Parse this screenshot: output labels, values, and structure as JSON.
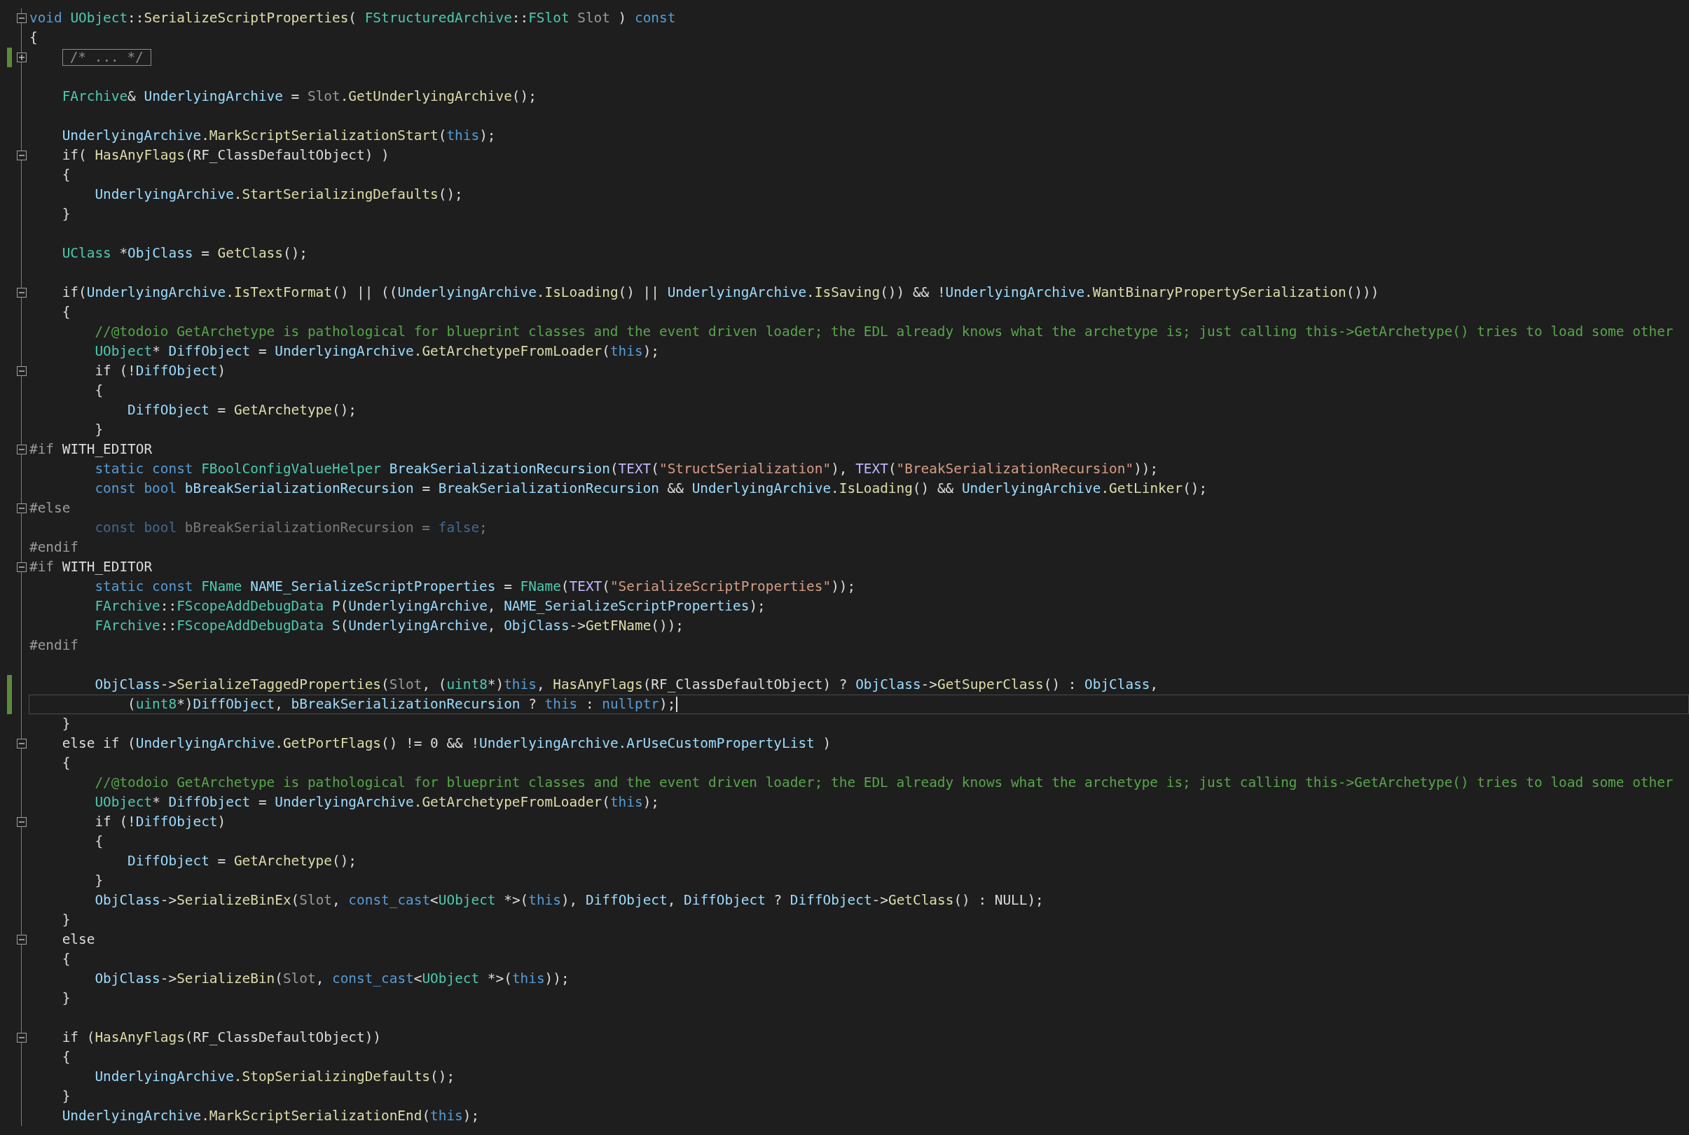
{
  "editor": {
    "lines": [
      {
        "expanded": true,
        "changed": false,
        "current": false,
        "tokens": [
          {
            "kind": "kw",
            "text": "void "
          },
          {
            "kind": "type",
            "text": "UObject"
          },
          {
            "kind": "plain",
            "text": "::"
          },
          {
            "kind": "fn",
            "text": "SerializeScriptProperties"
          },
          {
            "kind": "plain",
            "text": "( "
          },
          {
            "kind": "type",
            "text": "FStructuredArchive"
          },
          {
            "kind": "plain",
            "text": "::"
          },
          {
            "kind": "type",
            "text": "FSlot "
          },
          {
            "kind": "param",
            "text": "Slot"
          },
          {
            "kind": "plain",
            "text": " ) "
          },
          {
            "kind": "kw",
            "text": "const"
          }
        ]
      },
      {
        "changed": false,
        "current": false,
        "tokens": [
          {
            "kind": "plain",
            "text": "{"
          }
        ]
      },
      {
        "expanded": false,
        "changed": true,
        "current": false,
        "tokens": [
          {
            "kind": "collapsed",
            "text": "/* ... */"
          }
        ]
      },
      {
        "changed": false,
        "current": false
      },
      {
        "changed": false,
        "current": false,
        "tokens": [
          {
            "kind": "type",
            "text": "    FArchive"
          },
          {
            "kind": "plain",
            "text": "& "
          },
          {
            "kind": "var",
            "text": "UnderlyingArchive"
          },
          {
            "kind": "plain",
            "text": " = "
          },
          {
            "kind": "param",
            "text": "Slot"
          },
          {
            "kind": "fn",
            "text": ".GetUnderlyingArchive"
          },
          {
            "kind": "plain",
            "text": "();"
          }
        ]
      },
      {
        "changed": false,
        "current": false
      },
      {
        "changed": false,
        "current": false,
        "tokens": [
          {
            "kind": "var",
            "text": "    UnderlyingArchive"
          },
          {
            "kind": "fn",
            "text": ".MarkScriptSerializationStart"
          },
          {
            "kind": "plain",
            "text": "("
          },
          {
            "kind": "kw",
            "text": "this"
          },
          {
            "kind": "plain",
            "text": ");"
          }
        ]
      },
      {
        "expanded": true,
        "changed": false,
        "current": false,
        "tokens": [
          {
            "kind": "plain",
            "text": "    if( "
          },
          {
            "kind": "fn",
            "text": "HasAnyFlags"
          },
          {
            "kind": "plain",
            "text": "(RF_ClassDefaultObject) )"
          }
        ]
      },
      {
        "changed": false,
        "current": false,
        "tokens": [
          {
            "kind": "plain",
            "text": "    {"
          }
        ]
      },
      {
        "changed": false,
        "current": false,
        "tokens": [
          {
            "kind": "var",
            "text": "        UnderlyingArchive"
          },
          {
            "kind": "fn",
            "text": ".StartSerializingDefaults"
          },
          {
            "kind": "plain",
            "text": "();"
          }
        ]
      },
      {
        "changed": false,
        "current": false,
        "tokens": [
          {
            "kind": "plain",
            "text": "    }"
          }
        ]
      },
      {
        "changed": false,
        "current": false
      },
      {
        "changed": false,
        "current": false,
        "tokens": [
          {
            "kind": "type",
            "text": "    UClass"
          },
          {
            "kind": "plain",
            "text": " *"
          },
          {
            "kind": "var",
            "text": "ObjClass"
          },
          {
            "kind": "plain",
            "text": " = "
          },
          {
            "kind": "fn",
            "text": "GetClass"
          },
          {
            "kind": "plain",
            "text": "();"
          }
        ]
      },
      {
        "changed": false,
        "current": false
      },
      {
        "expanded": true,
        "changed": false,
        "current": false,
        "tokens": [
          {
            "kind": "plain",
            "text": "    if("
          },
          {
            "kind": "var",
            "text": "UnderlyingArchive"
          },
          {
            "kind": "fn",
            "text": ".IsTextFormat"
          },
          {
            "kind": "plain",
            "text": "() || (("
          },
          {
            "kind": "var",
            "text": "UnderlyingArchive"
          },
          {
            "kind": "fn",
            "text": ".IsLoading"
          },
          {
            "kind": "plain",
            "text": "() || "
          },
          {
            "kind": "var",
            "text": "UnderlyingArchive"
          },
          {
            "kind": "fn",
            "text": ".IsSaving"
          },
          {
            "kind": "plain",
            "text": "()) && !"
          },
          {
            "kind": "var",
            "text": "UnderlyingArchive"
          },
          {
            "kind": "fn",
            "text": ".WantBinaryPropertySerialization"
          },
          {
            "kind": "plain",
            "text": "()))"
          }
        ]
      },
      {
        "changed": false,
        "current": false,
        "tokens": [
          {
            "kind": "plain",
            "text": "    {"
          }
        ]
      },
      {
        "changed": false,
        "current": false,
        "tokens": [
          {
            "kind": "cmt",
            "text": "        //@todoio GetArchetype is pathological for blueprint classes and the event driven loader; the EDL already knows what the archetype is; just calling this->GetArchetype() tries to load some other"
          }
        ]
      },
      {
        "changed": false,
        "current": false,
        "tokens": [
          {
            "kind": "type",
            "text": "        UObject"
          },
          {
            "kind": "plain",
            "text": "* "
          },
          {
            "kind": "var",
            "text": "DiffObject"
          },
          {
            "kind": "plain",
            "text": " = "
          },
          {
            "kind": "var",
            "text": "UnderlyingArchive"
          },
          {
            "kind": "fn",
            "text": ".GetArchetypeFromLoader"
          },
          {
            "kind": "plain",
            "text": "("
          },
          {
            "kind": "kw",
            "text": "this"
          },
          {
            "kind": "plain",
            "text": ");"
          }
        ]
      },
      {
        "expanded": true,
        "changed": false,
        "current": false,
        "tokens": [
          {
            "kind": "plain",
            "text": "        if (!"
          },
          {
            "kind": "var",
            "text": "DiffObject"
          },
          {
            "kind": "plain",
            "text": ")"
          }
        ]
      },
      {
        "changed": false,
        "current": false,
        "tokens": [
          {
            "kind": "plain",
            "text": "        {"
          }
        ]
      },
      {
        "changed": false,
        "current": false,
        "tokens": [
          {
            "kind": "var",
            "text": "            DiffObject"
          },
          {
            "kind": "plain",
            "text": " = "
          },
          {
            "kind": "fn",
            "text": "GetArchetype"
          },
          {
            "kind": "plain",
            "text": "();"
          }
        ]
      },
      {
        "changed": false,
        "current": false,
        "tokens": [
          {
            "kind": "plain",
            "text": "        }"
          }
        ]
      },
      {
        "expanded": true,
        "changed": false,
        "current": false,
        "tokens": [
          {
            "kind": "pre",
            "text": "#if"
          },
          {
            "kind": "plain",
            "text": " WITH_EDITOR"
          }
        ]
      },
      {
        "changed": false,
        "current": false,
        "tokens": [
          {
            "kind": "kw",
            "text": "        static const "
          },
          {
            "kind": "type",
            "text": "FBoolConfigValueHelper "
          },
          {
            "kind": "var",
            "text": "BreakSerializationRecursion"
          },
          {
            "kind": "plain",
            "text": "("
          },
          {
            "kind": "macro",
            "text": "TEXT"
          },
          {
            "kind": "plain",
            "text": "("
          },
          {
            "kind": "str",
            "text": "\"StructSerialization\""
          },
          {
            "kind": "plain",
            "text": "), "
          },
          {
            "kind": "macro",
            "text": "TEXT"
          },
          {
            "kind": "plain",
            "text": "("
          },
          {
            "kind": "str",
            "text": "\"BreakSerializationRecursion\""
          },
          {
            "kind": "plain",
            "text": "));"
          }
        ]
      },
      {
        "changed": false,
        "current": false,
        "tokens": [
          {
            "kind": "kw",
            "text": "        const bool "
          },
          {
            "kind": "var",
            "text": "bBreakSerializationRecursion"
          },
          {
            "kind": "plain",
            "text": " = "
          },
          {
            "kind": "var",
            "text": "BreakSerializationRecursion"
          },
          {
            "kind": "plain",
            "text": " && "
          },
          {
            "kind": "var",
            "text": "UnderlyingArchive"
          },
          {
            "kind": "fn",
            "text": ".IsLoading"
          },
          {
            "kind": "plain",
            "text": "() && "
          },
          {
            "kind": "var",
            "text": "UnderlyingArchive"
          },
          {
            "kind": "fn",
            "text": ".GetLinker"
          },
          {
            "kind": "plain",
            "text": "();"
          }
        ]
      },
      {
        "expanded": true,
        "changed": false,
        "current": false,
        "tokens": [
          {
            "kind": "pre",
            "text": "#else"
          }
        ]
      },
      {
        "changed": false,
        "current": false,
        "tokens": [
          {
            "kind": "dimkw",
            "text": "        const bool "
          },
          {
            "kind": "dim",
            "text": "bBreakSerializationRecursion = "
          },
          {
            "kind": "dimkw",
            "text": "false"
          },
          {
            "kind": "dim",
            "text": ";"
          }
        ]
      },
      {
        "changed": false,
        "current": false,
        "tokens": [
          {
            "kind": "pre",
            "text": "#endif"
          }
        ]
      },
      {
        "expanded": true,
        "changed": false,
        "current": false,
        "tokens": [
          {
            "kind": "pre",
            "text": "#if"
          },
          {
            "kind": "plain",
            "text": " WITH_EDITOR"
          }
        ]
      },
      {
        "changed": false,
        "current": false,
        "tokens": [
          {
            "kind": "kw",
            "text": "        static const "
          },
          {
            "kind": "type",
            "text": "FName "
          },
          {
            "kind": "var",
            "text": "NAME_SerializeScriptProperties"
          },
          {
            "kind": "plain",
            "text": " = "
          },
          {
            "kind": "type",
            "text": "FName"
          },
          {
            "kind": "plain",
            "text": "("
          },
          {
            "kind": "macro",
            "text": "TEXT"
          },
          {
            "kind": "plain",
            "text": "("
          },
          {
            "kind": "str",
            "text": "\"SerializeScriptProperties\""
          },
          {
            "kind": "plain",
            "text": "));"
          }
        ]
      },
      {
        "changed": false,
        "current": false,
        "tokens": [
          {
            "kind": "type",
            "text": "        FArchive"
          },
          {
            "kind": "plain",
            "text": "::"
          },
          {
            "kind": "type",
            "text": "FScopeAddDebugData "
          },
          {
            "kind": "var",
            "text": "P"
          },
          {
            "kind": "plain",
            "text": "("
          },
          {
            "kind": "var",
            "text": "UnderlyingArchive"
          },
          {
            "kind": "plain",
            "text": ", "
          },
          {
            "kind": "var",
            "text": "NAME_SerializeScriptProperties"
          },
          {
            "kind": "plain",
            "text": ");"
          }
        ]
      },
      {
        "changed": false,
        "current": false,
        "tokens": [
          {
            "kind": "type",
            "text": "        FArchive"
          },
          {
            "kind": "plain",
            "text": "::"
          },
          {
            "kind": "type",
            "text": "FScopeAddDebugData "
          },
          {
            "kind": "var",
            "text": "S"
          },
          {
            "kind": "plain",
            "text": "("
          },
          {
            "kind": "var",
            "text": "UnderlyingArchive"
          },
          {
            "kind": "plain",
            "text": ", "
          },
          {
            "kind": "var",
            "text": "ObjClass"
          },
          {
            "kind": "plain",
            "text": "->"
          },
          {
            "kind": "fn",
            "text": "GetFName"
          },
          {
            "kind": "plain",
            "text": "());"
          }
        ]
      },
      {
        "changed": false,
        "current": false,
        "tokens": [
          {
            "kind": "pre",
            "text": "#endif"
          }
        ]
      },
      {
        "changed": false,
        "current": false
      },
      {
        "changed": true,
        "current": false,
        "tokens": [
          {
            "kind": "var",
            "text": "        ObjClass"
          },
          {
            "kind": "plain",
            "text": "->"
          },
          {
            "kind": "fn",
            "text": "SerializeTaggedProperties"
          },
          {
            "kind": "plain",
            "text": "("
          },
          {
            "kind": "param",
            "text": "Slot"
          },
          {
            "kind": "plain",
            "text": ", ("
          },
          {
            "kind": "type",
            "text": "uint8"
          },
          {
            "kind": "plain",
            "text": "*)"
          },
          {
            "kind": "kw",
            "text": "this"
          },
          {
            "kind": "plain",
            "text": ", "
          },
          {
            "kind": "fn",
            "text": "HasAnyFlags"
          },
          {
            "kind": "plain",
            "text": "(RF_ClassDefaultObject) ? "
          },
          {
            "kind": "var",
            "text": "ObjClass"
          },
          {
            "kind": "plain",
            "text": "->"
          },
          {
            "kind": "fn",
            "text": "GetSuperClass"
          },
          {
            "kind": "plain",
            "text": "() : "
          },
          {
            "kind": "var",
            "text": "ObjClass"
          },
          {
            "kind": "plain",
            "text": ","
          }
        ]
      },
      {
        "changed": true,
        "current": true,
        "tokens": [
          {
            "kind": "plain",
            "text": "            ("
          },
          {
            "kind": "type",
            "text": "uint8"
          },
          {
            "kind": "plain",
            "text": "*)"
          },
          {
            "kind": "var",
            "text": "DiffObject"
          },
          {
            "kind": "plain",
            "text": ", "
          },
          {
            "kind": "var",
            "text": "bBreakSerializationRecursion"
          },
          {
            "kind": "plain",
            "text": " ? "
          },
          {
            "kind": "kw",
            "text": "this"
          },
          {
            "kind": "plain",
            "text": " : "
          },
          {
            "kind": "kw",
            "text": "nullptr"
          },
          {
            "kind": "plain",
            "text": ");"
          }
        ]
      },
      {
        "changed": false,
        "current": false,
        "tokens": [
          {
            "kind": "plain",
            "text": "    }"
          }
        ]
      },
      {
        "expanded": true,
        "changed": false,
        "current": false,
        "tokens": [
          {
            "kind": "plain",
            "text": "    else if ("
          },
          {
            "kind": "var",
            "text": "UnderlyingArchive"
          },
          {
            "kind": "fn",
            "text": ".GetPortFlags"
          },
          {
            "kind": "plain",
            "text": "() != 0 && !"
          },
          {
            "kind": "var",
            "text": "UnderlyingArchive"
          },
          {
            "kind": "var",
            "text": ".ArUseCustomPropertyList"
          },
          {
            "kind": "plain",
            "text": " )"
          }
        ]
      },
      {
        "changed": false,
        "current": false,
        "tokens": [
          {
            "kind": "plain",
            "text": "    {"
          }
        ]
      },
      {
        "changed": false,
        "current": false,
        "tokens": [
          {
            "kind": "cmt",
            "text": "        //@todoio GetArchetype is pathological for blueprint classes and the event driven loader; the EDL already knows what the archetype is; just calling this->GetArchetype() tries to load some other"
          }
        ]
      },
      {
        "changed": false,
        "current": false,
        "tokens": [
          {
            "kind": "type",
            "text": "        UObject"
          },
          {
            "kind": "plain",
            "text": "* "
          },
          {
            "kind": "var",
            "text": "DiffObject"
          },
          {
            "kind": "plain",
            "text": " = "
          },
          {
            "kind": "var",
            "text": "UnderlyingArchive"
          },
          {
            "kind": "fn",
            "text": ".GetArchetypeFromLoader"
          },
          {
            "kind": "plain",
            "text": "("
          },
          {
            "kind": "kw",
            "text": "this"
          },
          {
            "kind": "plain",
            "text": ");"
          }
        ]
      },
      {
        "expanded": true,
        "changed": false,
        "current": false,
        "tokens": [
          {
            "kind": "plain",
            "text": "        if (!"
          },
          {
            "kind": "var",
            "text": "DiffObject"
          },
          {
            "kind": "plain",
            "text": ")"
          }
        ]
      },
      {
        "changed": false,
        "current": false,
        "tokens": [
          {
            "kind": "plain",
            "text": "        {"
          }
        ]
      },
      {
        "changed": false,
        "current": false,
        "tokens": [
          {
            "kind": "var",
            "text": "            DiffObject"
          },
          {
            "kind": "plain",
            "text": " = "
          },
          {
            "kind": "fn",
            "text": "GetArchetype"
          },
          {
            "kind": "plain",
            "text": "();"
          }
        ]
      },
      {
        "changed": false,
        "current": false,
        "tokens": [
          {
            "kind": "plain",
            "text": "        }"
          }
        ]
      },
      {
        "changed": false,
        "current": false,
        "tokens": [
          {
            "kind": "var",
            "text": "        ObjClass"
          },
          {
            "kind": "plain",
            "text": "->"
          },
          {
            "kind": "fn",
            "text": "SerializeBinEx"
          },
          {
            "kind": "plain",
            "text": "("
          },
          {
            "kind": "param",
            "text": "Slot"
          },
          {
            "kind": "plain",
            "text": ", "
          },
          {
            "kind": "kw",
            "text": "const_cast"
          },
          {
            "kind": "plain",
            "text": "<"
          },
          {
            "kind": "type",
            "text": "UObject"
          },
          {
            "kind": "plain",
            "text": " *>("
          },
          {
            "kind": "kw",
            "text": "this"
          },
          {
            "kind": "plain",
            "text": "), "
          },
          {
            "kind": "var",
            "text": "DiffObject"
          },
          {
            "kind": "plain",
            "text": ", "
          },
          {
            "kind": "var",
            "text": "DiffObject"
          },
          {
            "kind": "plain",
            "text": " ? "
          },
          {
            "kind": "var",
            "text": "DiffObject"
          },
          {
            "kind": "plain",
            "text": "->"
          },
          {
            "kind": "fn",
            "text": "GetClass"
          },
          {
            "kind": "plain",
            "text": "() : NULL);"
          }
        ]
      },
      {
        "changed": false,
        "current": false,
        "tokens": [
          {
            "kind": "plain",
            "text": "    }"
          }
        ]
      },
      {
        "expanded": true,
        "changed": false,
        "current": false,
        "tokens": [
          {
            "kind": "plain",
            "text": "    else"
          }
        ]
      },
      {
        "changed": false,
        "current": false,
        "tokens": [
          {
            "kind": "plain",
            "text": "    {"
          }
        ]
      },
      {
        "changed": false,
        "current": false,
        "tokens": [
          {
            "kind": "var",
            "text": "        ObjClass"
          },
          {
            "kind": "plain",
            "text": "->"
          },
          {
            "kind": "fn",
            "text": "SerializeBin"
          },
          {
            "kind": "plain",
            "text": "("
          },
          {
            "kind": "param",
            "text": "Slot"
          },
          {
            "kind": "plain",
            "text": ", "
          },
          {
            "kind": "kw",
            "text": "const_cast"
          },
          {
            "kind": "plain",
            "text": "<"
          },
          {
            "kind": "type",
            "text": "UObject"
          },
          {
            "kind": "plain",
            "text": " *>("
          },
          {
            "kind": "kw",
            "text": "this"
          },
          {
            "kind": "plain",
            "text": "));"
          }
        ]
      },
      {
        "changed": false,
        "current": false,
        "tokens": [
          {
            "kind": "plain",
            "text": "    }"
          }
        ]
      },
      {
        "changed": false,
        "current": false
      },
      {
        "expanded": true,
        "changed": false,
        "current": false,
        "tokens": [
          {
            "kind": "plain",
            "text": "    if ("
          },
          {
            "kind": "fn",
            "text": "HasAnyFlags"
          },
          {
            "kind": "plain",
            "text": "(RF_ClassDefaultObject))"
          }
        ]
      },
      {
        "changed": false,
        "current": false,
        "tokens": [
          {
            "kind": "plain",
            "text": "    {"
          }
        ]
      },
      {
        "changed": false,
        "current": false,
        "tokens": [
          {
            "kind": "var",
            "text": "        UnderlyingArchive"
          },
          {
            "kind": "fn",
            "text": ".StopSerializingDefaults"
          },
          {
            "kind": "plain",
            "text": "();"
          }
        ]
      },
      {
        "changed": false,
        "current": false,
        "tokens": [
          {
            "kind": "plain",
            "text": "    }"
          }
        ]
      },
      {
        "changed": false,
        "current": false,
        "tokens": [
          {
            "kind": "var",
            "text": "    UnderlyingArchive"
          },
          {
            "kind": "fn",
            "text": ".MarkScriptSerializationEnd"
          },
          {
            "kind": "plain",
            "text": "("
          },
          {
            "kind": "kw",
            "text": "this"
          },
          {
            "kind": "plain",
            "text": ");"
          }
        ]
      }
    ]
  }
}
